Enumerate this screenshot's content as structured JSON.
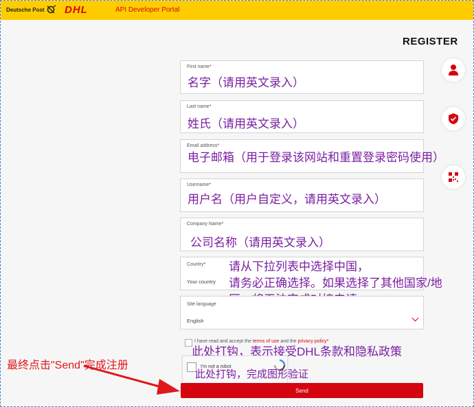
{
  "header": {
    "deutsche_post": "Deutsche Post",
    "dhl": "DHL",
    "portal": "API Developer Portal"
  },
  "page_title": "REGISTER",
  "fields": {
    "first_name": {
      "label": "First name",
      "star": "*",
      "annotation": "名字（请用英文录入）"
    },
    "last_name": {
      "label": "Last name",
      "star": "*",
      "annotation": "姓氏（请用英文录入）"
    },
    "email": {
      "label": "Email address",
      "star": "*",
      "annotation": "电子邮箱（用于登录该网站和重置登录密码使用）"
    },
    "username": {
      "label": "Username",
      "star": "*",
      "annotation": "用户名（用户自定义，请用英文录入）"
    },
    "company": {
      "label": "Company Name",
      "star": "*",
      "annotation": "公司名称（请用英文录入）"
    },
    "country": {
      "label": "Country",
      "star": "*",
      "placeholder": "Your country",
      "annotation_line1": "请从下拉列表中选择中国，",
      "annotation_line2": "请务必正确选择。如果选择了其他国家/地",
      "annotation_line3": "区，将无法完成对接申请"
    },
    "site_language": {
      "label": "Site language",
      "value": "English"
    }
  },
  "terms": {
    "prefix": "I have read and accept the",
    "terms_link": "terms of use",
    "and": "and the",
    "privacy_link": "privacy policy",
    "star": "*",
    "annotation": "此处打钩，表示接受DHL条款和隐私政策"
  },
  "captcha": {
    "label": "I'm not a robot",
    "annotation": "此处打钩，完成图形验证"
  },
  "send_button": "Send",
  "final_annotation": "最终点击\"Send\"完成注册",
  "colors": {
    "brand_yellow": "#ffcc00",
    "brand_red": "#d40511",
    "annotation_purple": "#7a1fa2",
    "annotation_red": "#e0171b"
  },
  "side_icons": [
    "user-icon",
    "shield-icon",
    "qr-code-icon"
  ]
}
